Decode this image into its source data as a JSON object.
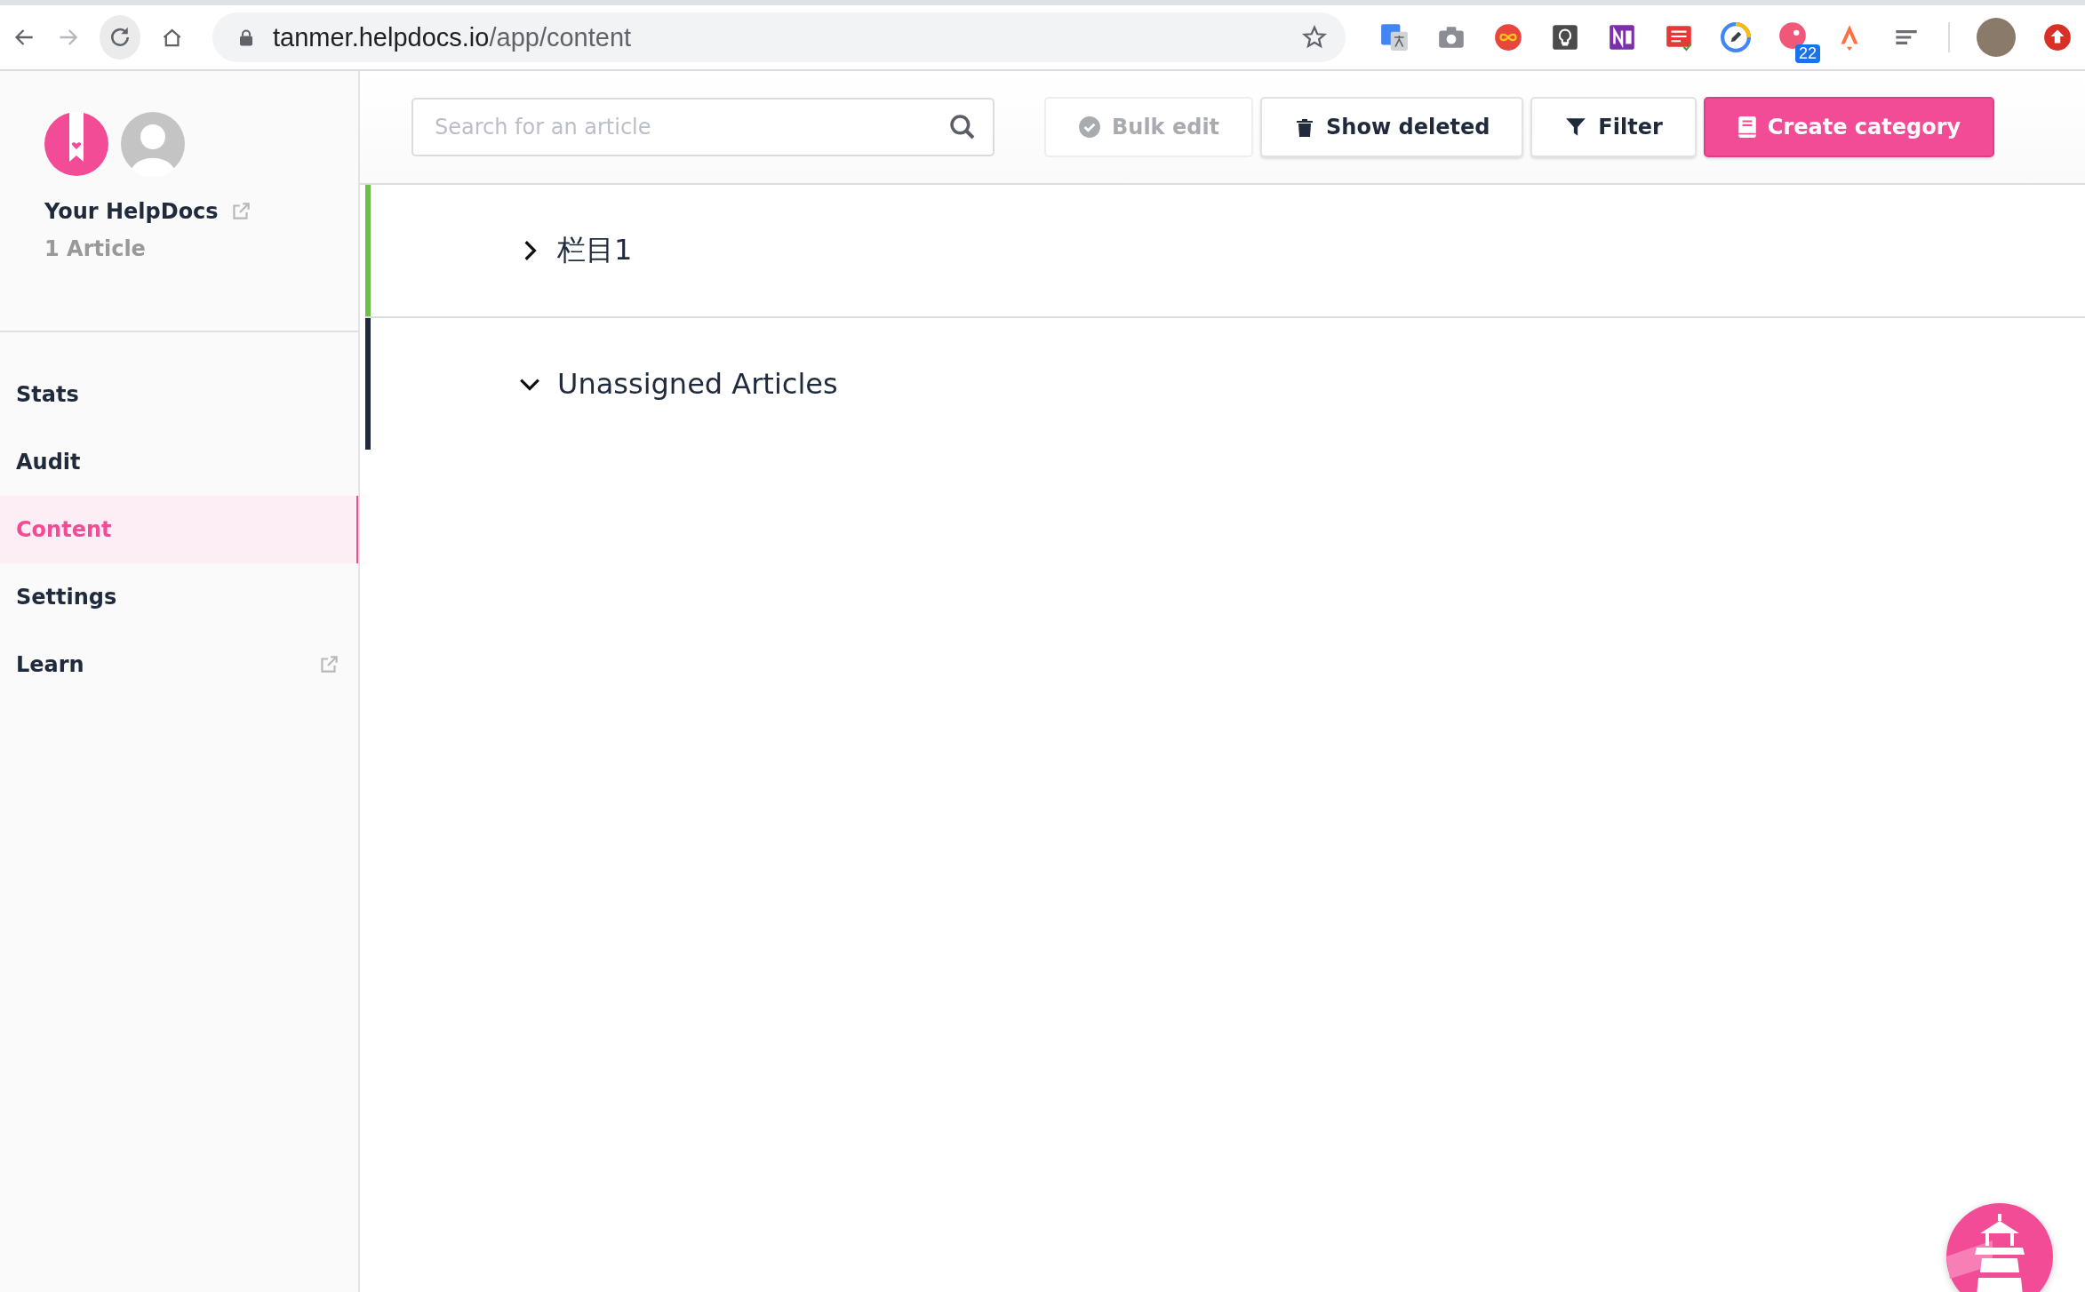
{
  "browser": {
    "url_host": "tanmer.helpdocs.io",
    "url_path": "/app/content",
    "extension_badge": "22"
  },
  "sidebar": {
    "site_name": "Your HelpDocs",
    "article_count": "1 Article",
    "items": [
      {
        "label": "Stats",
        "selected": false,
        "external": false
      },
      {
        "label": "Audit",
        "selected": false,
        "external": false
      },
      {
        "label": "Content",
        "selected": true,
        "external": false
      },
      {
        "label": "Settings",
        "selected": false,
        "external": false
      },
      {
        "label": "Learn",
        "selected": false,
        "external": true
      }
    ]
  },
  "toolbar": {
    "search": {
      "placeholder": "Search for an article"
    },
    "buttons": [
      {
        "label": "Bulk edit",
        "kind": "bulk",
        "disabled": true
      },
      {
        "label": "Show deleted",
        "kind": "trash",
        "disabled": false
      },
      {
        "label": "Filter",
        "kind": "filter",
        "disabled": false
      },
      {
        "label": "Create category",
        "kind": "create",
        "disabled": false
      }
    ]
  },
  "categories": [
    {
      "title": "栏目1",
      "expanded": false,
      "color": "#6cc04a"
    },
    {
      "title": "Unassigned Articles",
      "expanded": true,
      "color": "#1f2a3c"
    }
  ]
}
